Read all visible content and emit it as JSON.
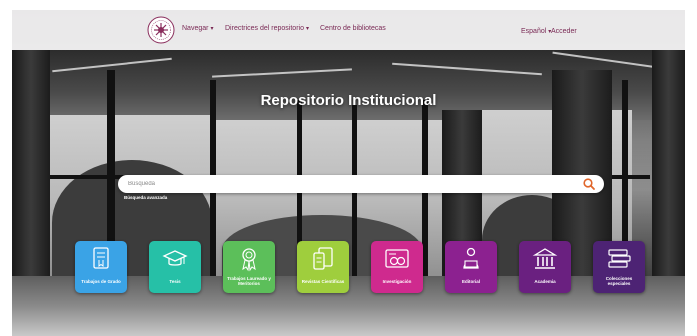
{
  "nav": {
    "items": [
      {
        "label": "Navegar",
        "caret": "▾"
      },
      {
        "label": "Directrices del repositorio",
        "caret": "▾"
      },
      {
        "label": "Centro de bibliotecas",
        "caret": ""
      }
    ],
    "language": "Español",
    "login": "Acceder",
    "colors": {
      "text": "#7a2a55",
      "bar": "#f8f6f7"
    }
  },
  "hero": {
    "title": "Repositorio Institucional"
  },
  "search": {
    "placeholder": "Búsqueda",
    "advanced": "Búsqueda avanzada",
    "icon": "search-icon",
    "icon_color": "#e0662b"
  },
  "tiles": [
    {
      "label": "Trabajos de Grado",
      "color": "#3aa3e6",
      "icon": "document-icon"
    },
    {
      "label": "Tesis",
      "color": "#26c0a7",
      "icon": "graduation-cap-icon"
    },
    {
      "label": "Trabajos Laureado y Meritorios",
      "color": "#5cbf5a",
      "icon": "award-ribbon-icon"
    },
    {
      "label": "Revistas Científicas",
      "color": "#9fce3d",
      "icon": "journal-icon"
    },
    {
      "label": "Investigación",
      "color": "#cf2a8e",
      "icon": "research-icon"
    },
    {
      "label": "Editorial",
      "color": "#8c2190",
      "icon": "reader-icon"
    },
    {
      "label": "Academia",
      "color": "#6a2080",
      "icon": "academy-building-icon"
    },
    {
      "label": "Colecciones especiales",
      "color": "#4d2374",
      "icon": "stacked-books-icon"
    }
  ]
}
